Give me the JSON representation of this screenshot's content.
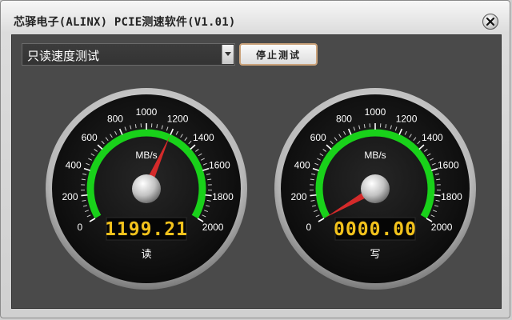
{
  "window": {
    "title": "芯驿电子(ALINX) PCIE测速软件(V1.01)"
  },
  "toolbar": {
    "mode_select_value": "只读速度测试",
    "stop_button_label": "停止测试"
  },
  "gauges": [
    {
      "id": "read",
      "caption": "读",
      "unit": "MB/s",
      "readout": "1199.21",
      "value": 1199.21,
      "min": 0,
      "max": 2000,
      "ticks": [
        "0",
        "200",
        "400",
        "600",
        "800",
        "1000",
        "1200",
        "1400",
        "1600",
        "1800",
        "2000"
      ],
      "arc_color": "#19d11a",
      "needle_color": "#d42a2a",
      "readout_color": "#f2c21c"
    },
    {
      "id": "write",
      "caption": "写",
      "unit": "MB/s",
      "readout": "0000.00",
      "value": 0,
      "min": 0,
      "max": 2000,
      "ticks": [
        "0",
        "200",
        "400",
        "600",
        "800",
        "1000",
        "1200",
        "1400",
        "1600",
        "1800",
        "2000"
      ],
      "arc_color": "#19d11a",
      "needle_color": "#d42a2a",
      "readout_color": "#f2c21c"
    }
  ],
  "icons": {
    "close": "close-icon",
    "dropdown": "chevron-down-icon"
  }
}
